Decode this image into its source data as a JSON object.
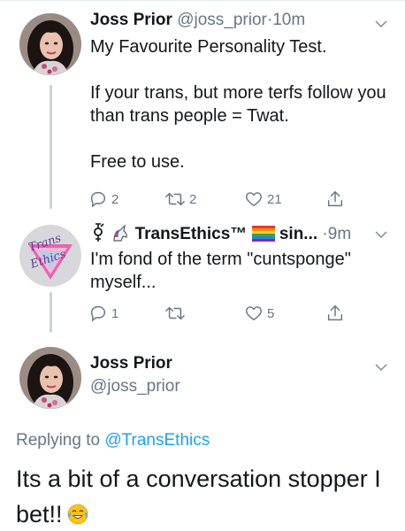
{
  "colors": {
    "text": "#14171a",
    "muted": "#657786",
    "link": "#1da1f2",
    "thread_line": "#c8d2da"
  },
  "tweets": [
    {
      "avatar": "user-avatar-photo",
      "name": "Joss Prior",
      "handle": "@joss_prior",
      "dot": "·",
      "time": "10m",
      "body": {
        "line1": "My Favourite Personality Test.",
        "line2": "If your trans, but more terfs follow you than trans people = Twat.",
        "line3": "Free to use."
      },
      "actions": {
        "reply": "2",
        "retweet": "2",
        "like": "21"
      }
    },
    {
      "avatar": "transethics-logo",
      "name_prefix_icons": [
        "gender-symbol-icon",
        "unicorn-icon"
      ],
      "name": "TransEthics™",
      "name_suffix_icon": "rainbow-flag-icon",
      "name_truncated": "sin...",
      "dot": "·",
      "time": "9m",
      "body": {
        "line1": "I'm fond of the term \"cuntsponge\" myself..."
      },
      "actions": {
        "reply": "1",
        "retweet": "",
        "like": "5"
      }
    }
  ],
  "focused_tweet": {
    "avatar": "user-avatar-photo",
    "name": "Joss Prior",
    "handle": "@joss_prior",
    "replying_prefix": "Replying to",
    "replying_to": "@TransEthics",
    "text": "Its a bit of a conversation stopper I bet!!",
    "emoji": "tears-of-joy-emoji"
  }
}
